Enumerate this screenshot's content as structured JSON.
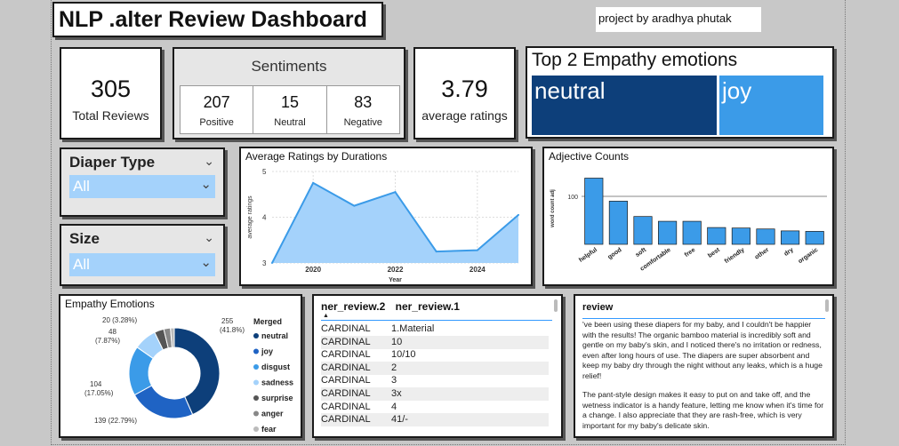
{
  "header": {
    "title": "NLP .alter Review Dashboard",
    "credit": "project by aradhya phutak"
  },
  "kpis": {
    "total_reviews": {
      "value": "305",
      "label": "Total Reviews"
    },
    "average_ratings": {
      "value": "3.79",
      "label": "average ratings"
    }
  },
  "sentiments": {
    "title": "Sentiments",
    "items": [
      {
        "value": "207",
        "label": "Positive"
      },
      {
        "value": "15",
        "label": "Neutral"
      },
      {
        "value": "83",
        "label": "Negative"
      }
    ]
  },
  "empathy_top": {
    "title": "Top 2 Empathy emotions",
    "first": "neutral",
    "second": "joy"
  },
  "slicers": {
    "diaper": {
      "label": "Diaper Type",
      "value": "All"
    },
    "size": {
      "label": "Size",
      "value": "All"
    }
  },
  "table": {
    "col1": "ner_review.2",
    "col2": "ner_review.1",
    "rows": [
      [
        "CARDINAL",
        "1.Material"
      ],
      [
        "CARDINAL",
        "10"
      ],
      [
        "CARDINAL",
        "10/10"
      ],
      [
        "CARDINAL",
        "2"
      ],
      [
        "CARDINAL",
        "3"
      ],
      [
        "CARDINAL",
        "3x"
      ],
      [
        "CARDINAL",
        "4"
      ],
      [
        "CARDINAL",
        "41/-"
      ]
    ]
  },
  "review": {
    "header": "review",
    "p1": "'ve been using these diapers for my baby, and I couldn't be happier with the results! The organic bamboo material is incredibly soft and gentle on my baby's skin, and I noticed there's no irritation or redness, even after long hours of use. The diapers are super absorbent and keep my baby dry through the night without any leaks, which is a huge relief!",
    "p2": "The pant-style design makes it easy to put on and take off, and the wetness indicator is a handy feature, letting me know when it's time for a change. I also appreciate that they are rash-free, which is very important for my baby's delicate skin."
  },
  "colors": {
    "neutral": "#0d3f7a",
    "joy": "#3b9be8",
    "area": "#a4d2fb",
    "line": "#3b9be8"
  },
  "chart_data": [
    {
      "type": "area",
      "title": "Average Ratings by Durations",
      "xlabel": "Year",
      "ylabel": "average ratings",
      "x": [
        2019,
        2020,
        2021,
        2022,
        2023,
        2024,
        2025
      ],
      "values": [
        3.0,
        4.75,
        4.25,
        4.55,
        3.25,
        3.28,
        4.05
      ],
      "xticks": [
        "2020",
        "2022",
        "2024"
      ],
      "yticks": [
        "3",
        "4",
        "5"
      ],
      "ylim": [
        3,
        5
      ]
    },
    {
      "type": "bar",
      "title": "Adjective Counts",
      "ylabel": "word count adj",
      "yticks": [
        "100"
      ],
      "categories": [
        "helpful",
        "good",
        "soft",
        "comfortable",
        "free",
        "best",
        "friendly",
        "other",
        "dry",
        "organic"
      ],
      "values": [
        138,
        90,
        58,
        48,
        48,
        35,
        34,
        32,
        28,
        27
      ],
      "ylim": [
        0,
        150
      ]
    },
    {
      "type": "pie",
      "title": "Empathy Emotions",
      "legend_title": "Merged",
      "categories": [
        "neutral",
        "joy",
        "disgust",
        "sadness",
        "surprise",
        "anger",
        "fear"
      ],
      "values": [
        255,
        139,
        104,
        48,
        20,
        14,
        8
      ],
      "colors": [
        "#0d3f7a",
        "#1f63c4",
        "#3b9be8",
        "#a4d2fb",
        "#555555",
        "#888888",
        "#bbbbbb"
      ],
      "data_labels": [
        "255 (41.8%)",
        "139 (22.79%)",
        "104 (17.05%)",
        "48 (7.87%)",
        "20 (3.28%)"
      ]
    }
  ]
}
